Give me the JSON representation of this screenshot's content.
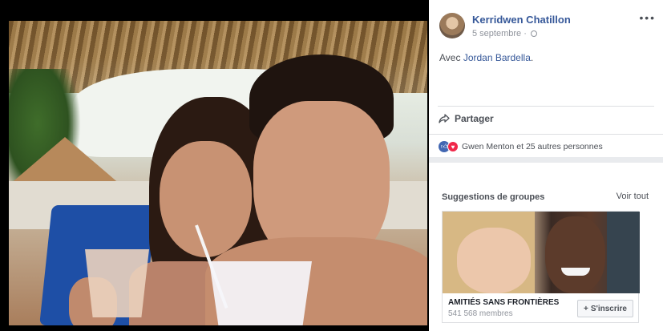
{
  "post": {
    "author": "Kerridwen Chatillon",
    "date": "5 septembre",
    "separator": "·",
    "caption_prefix": "Avec",
    "tagged": "Jordan Bardella",
    "caption_suffix": ".",
    "options_icon": "ellipsis-icon"
  },
  "actions": {
    "share_label": "Partager"
  },
  "reactions": {
    "text": "Gwen Menton et 25 autres personnes",
    "like_icon": "like-icon",
    "love_icon": "love-icon"
  },
  "groups": {
    "heading": "Suggestions de groupes",
    "see_all": "Voir tout",
    "items": [
      {
        "name": "AMITIÉS SANS FRONTIÈRES",
        "members": "541 568 membres",
        "join_label": "S'inscrire",
        "join_prefix": "+"
      }
    ]
  },
  "colors": {
    "link": "#365899",
    "like": "#4267b2",
    "love": "#f0284a"
  }
}
